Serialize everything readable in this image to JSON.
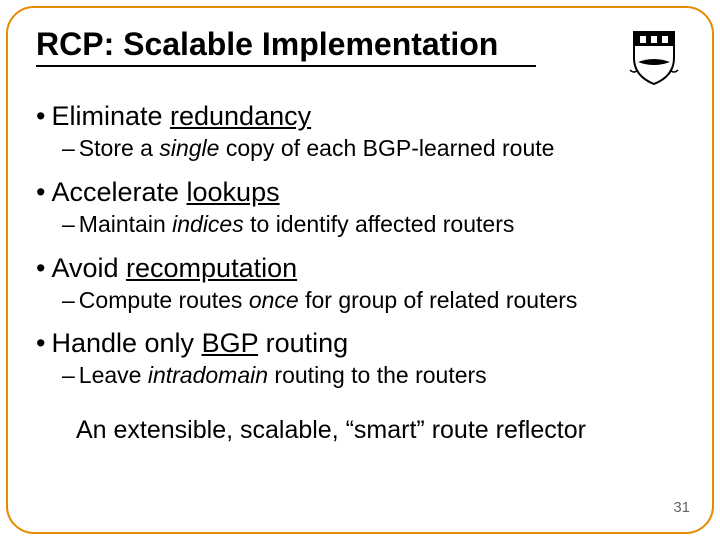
{
  "title": "RCP: Scalable Implementation",
  "bullets": [
    {
      "heading_pre": "Eliminate ",
      "heading_ul": "redundancy",
      "heading_post": "",
      "sub_pre": "Store a ",
      "sub_it": "single",
      "sub_post": " copy of each BGP-learned route"
    },
    {
      "heading_pre": "Accelerate ",
      "heading_ul": "lookups",
      "heading_post": "",
      "sub_pre": "Maintain ",
      "sub_it": "indices",
      "sub_post": " to identify affected routers"
    },
    {
      "heading_pre": "Avoid ",
      "heading_ul": "recomputation",
      "heading_post": "",
      "sub_pre": "Compute routes ",
      "sub_it": "once",
      "sub_post": " for group of related routers"
    },
    {
      "heading_pre": "Handle only ",
      "heading_ul": "BGP",
      "heading_post": " routing",
      "sub_pre": "Leave ",
      "sub_it": "intradomain",
      "sub_post": " routing to the routers"
    }
  ],
  "closing": "An extensible, scalable, “smart” route reflector",
  "page_number": "31",
  "crest_alt": "princeton-shield-icon"
}
